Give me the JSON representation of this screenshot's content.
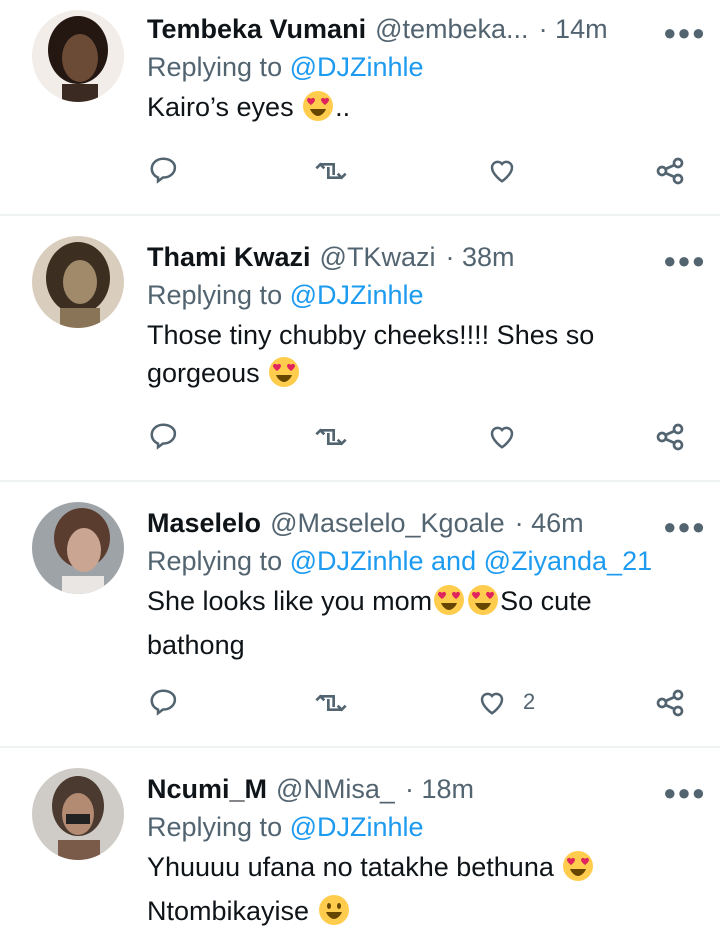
{
  "tweets": [
    {
      "name": "Tembeka Vumani",
      "handle": "@tembeka...",
      "time": "· 14m",
      "replying_prefix": "Replying to ",
      "mentions": "@DJZinhle",
      "text_parts": [
        "Kairo’s eyes ",
        ".."
      ],
      "like_count": "",
      "avatar_colors": [
        "#6b4a36",
        "#2a1a12"
      ]
    },
    {
      "name": "Thami Kwazi",
      "handle": "@TKwazi",
      "time": "· 38m",
      "replying_prefix": "Replying to ",
      "mentions": "@DJZinhle",
      "text_parts": [
        "Those tiny chubby cheeks!!!! Shes so gorgeous "
      ],
      "like_count": "",
      "avatar_colors": [
        "#a08a6a",
        "#3d2e22"
      ]
    },
    {
      "name": "Maselelo",
      "handle": "@Maselelo_Kgoale",
      "time": "· 46m",
      "replying_prefix": "Replying to ",
      "mentions": "@DJZinhle and @Ziyanda_21",
      "text_parts": [
        "She looks like you mom",
        "So cute bathong"
      ],
      "like_count": "2",
      "avatar_colors": [
        "#c9a592",
        "#5b3d30"
      ]
    },
    {
      "name": "Ncumi_M",
      "handle": "@NMisa_",
      "time": "· 18m",
      "replying_prefix": "Replying to ",
      "mentions": "@DJZinhle",
      "text_parts": [
        "Yhuuuu ufana no tatakhe bethuna ",
        "Ntombikayise "
      ],
      "like_count": "",
      "avatar_colors": [
        "#b7b3ae",
        "#7a5a48"
      ]
    }
  ],
  "icons": {
    "reply": "reply-icon",
    "retweet": "retweet-icon",
    "like": "heart-icon",
    "share": "share-icon",
    "more": "more-icon",
    "heart_eyes": "heart-eyes-emoji",
    "smiley": "smiley-emoji"
  },
  "colors": {
    "text": "#0f1419",
    "secondary": "#536471",
    "link": "#1d9bf0",
    "divider": "#eff3f4"
  }
}
